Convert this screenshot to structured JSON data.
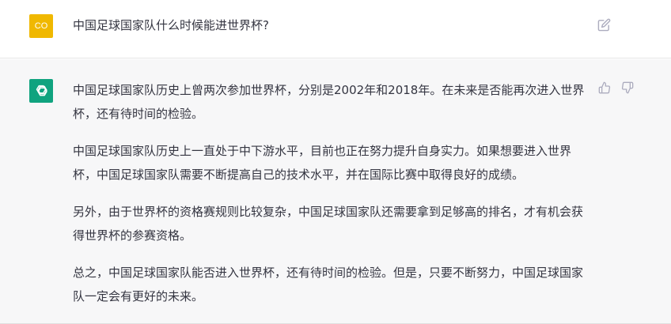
{
  "user_message": {
    "avatar_initials": "CO",
    "text": "中国足球国家队什么时候能进世界杯?"
  },
  "assistant_message": {
    "paragraphs": [
      "中国足球国家队历史上曾两次参加世界杯，分别是2002年和2018年。在未来是否能再次进入世界杯，还有待时间的检验。",
      "中国足球国家队历史上一直处于中下游水平，目前也正在努力提升自身实力。如果想要进入世界杯，中国足球国家队需要不断提高自己的技术水平，并在国际比赛中取得良好的成绩。",
      "另外，由于世界杯的资格赛规则比较复杂，中国足球国家队还需要拿到足够高的排名，才有机会获得世界杯的参赛资格。",
      "总之，中国足球国家队能否进入世界杯，还有待时间的检验。但是，只要不断努力，中国足球国家队一定会有更好的未来。"
    ]
  },
  "colors": {
    "user_avatar": "#f0b800",
    "assistant_avatar": "#10a37f",
    "assistant_bg": "#f7f7f8"
  },
  "icons": {
    "edit": "edit-icon",
    "thumbs_up": "thumbs-up-icon",
    "thumbs_down": "thumbs-down-icon",
    "assistant_logo": "openai-logo-icon"
  }
}
